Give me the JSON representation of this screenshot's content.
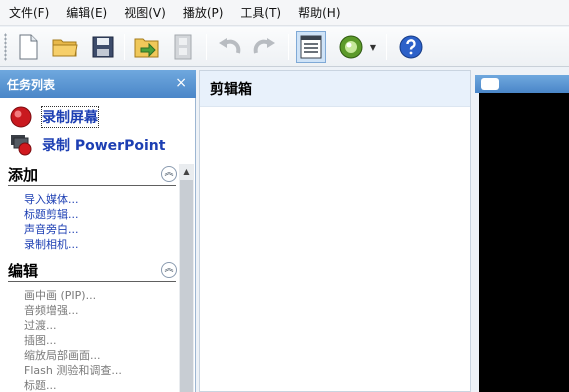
{
  "menu": [
    "文件(F)",
    "编辑(E)",
    "视图(V)",
    "播放(P)",
    "工具(T)",
    "帮助(H)"
  ],
  "toolbar": {
    "buttons": [
      {
        "icon": "new-file-icon",
        "enabled": true
      },
      {
        "icon": "open-folder-icon",
        "enabled": true
      },
      {
        "icon": "save-icon",
        "enabled": true
      },
      {
        "icon": "import-icon",
        "enabled": true
      },
      {
        "icon": "film-strip-icon",
        "enabled": false
      },
      {
        "icon": "undo-icon",
        "enabled": false
      },
      {
        "icon": "redo-icon",
        "enabled": false
      },
      {
        "icon": "task-list-icon",
        "enabled": true,
        "active": true
      },
      {
        "icon": "record-orb-icon",
        "enabled": true
      },
      {
        "icon": "help-icon",
        "enabled": true
      }
    ]
  },
  "task_pane": {
    "title": "任务列表",
    "close": "×",
    "record_screen": "录制屏幕",
    "record_ppt": "录制 PowerPoint",
    "add": {
      "title": "添加",
      "items": [
        "导入媒体...",
        "标题剪辑...",
        "声音旁白...",
        "录制相机..."
      ]
    },
    "edit": {
      "title": "编辑",
      "items": [
        "画中画 (PIP)...",
        "音频增强...",
        "过渡...",
        "插图...",
        "缩放局部画面...",
        "Flash 测验和调查...",
        "标题..."
      ]
    }
  },
  "clip_bin": {
    "title": "剪辑箱"
  },
  "colors": {
    "accent": "#4a86c8",
    "link": "#1d3fb3",
    "disabled": "#7a7a7a"
  }
}
